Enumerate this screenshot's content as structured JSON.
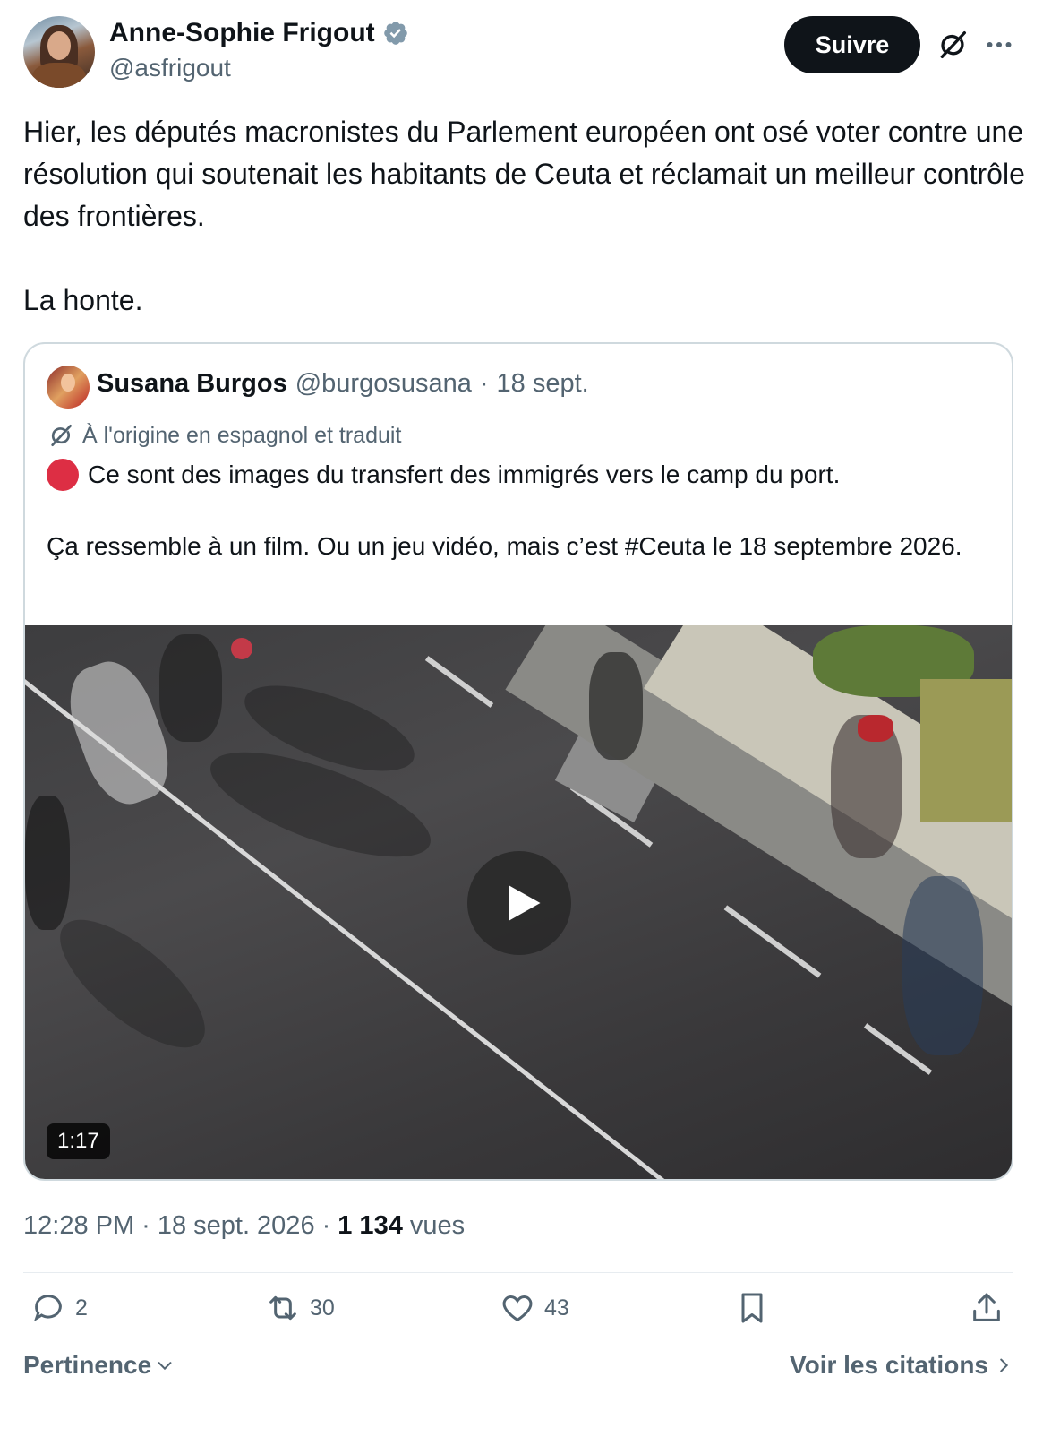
{
  "author": {
    "name": "Anne-Sophie Frigout",
    "handle": "@asfrigout",
    "verified_icon": "verified-badge-icon"
  },
  "header": {
    "follow_label": "Suivre",
    "grok_icon": "grok-icon",
    "more_icon": "more-icon"
  },
  "tweet": {
    "text": "Hier, les députés macronistes du Parlement européen ont osé voter contre une résolution qui soutenait les habitants de Ceuta et réclamait un meilleur contrôle des frontières.\n\nLa honte."
  },
  "quote": {
    "name": "Susana Burgos",
    "handle": "@burgosusana",
    "separator": "·",
    "date": "18 sept.",
    "translated_label": "À l'origine en espagnol et traduit",
    "line1": "Ce sont des images du transfert des immigrés vers le camp du port.",
    "line2": "Ça ressemble à un film. Ou un jeu vidéo, mais c’est #Ceuta le 18 septembre 2026.",
    "video_duration": "1:17"
  },
  "meta": {
    "time": "12:28 PM",
    "sep1": "·",
    "date": "18 sept. 2026",
    "sep2": "·",
    "views_count": "1 134",
    "views_label": "vues"
  },
  "actions": {
    "replies": "2",
    "reposts": "30",
    "likes": "43"
  },
  "footer": {
    "sort_label": "Pertinence",
    "quotes_label": "Voir les citations"
  },
  "colors": {
    "text": "#0f1419",
    "secondary": "#536471",
    "border": "#cfd9de",
    "red_dot": "#dd2e44",
    "verified": "#829aab"
  }
}
